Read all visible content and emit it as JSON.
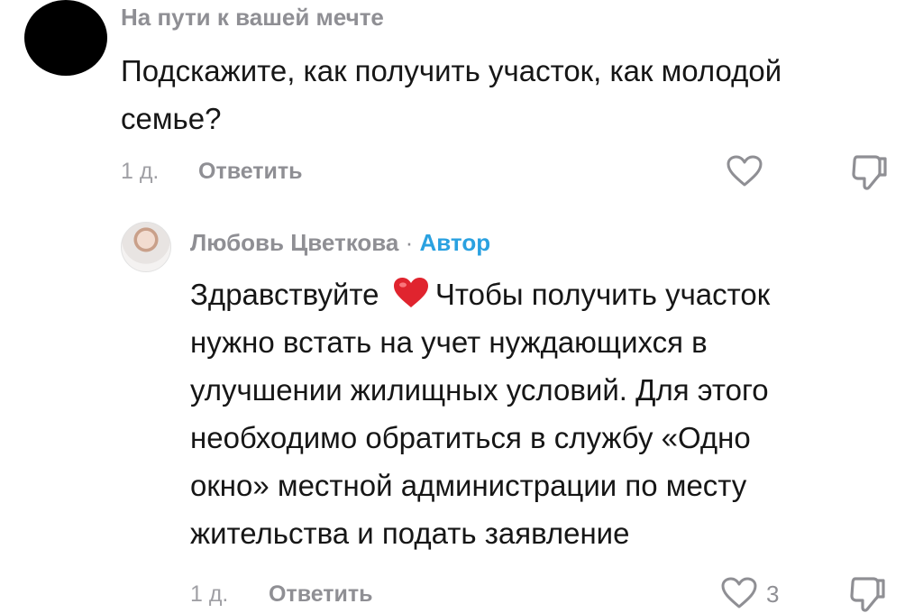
{
  "comment": {
    "username": "На пути к вашей мечте",
    "text_line1": "Подскажите, как получить участок, как молодой",
    "text_line2": "семье?",
    "time": "1 д.",
    "reply_label": "Ответить"
  },
  "reply": {
    "username": "Любовь Цветкова",
    "separator": "·",
    "author_label": "Автор",
    "lines": [
      "Здравствуйте",
      "Чтобы получить участок",
      "нужно встать на учет нуждающихся в",
      "улучшении жилищных условий. Для этого",
      "необходимо обратиться в службу «Одно",
      "окно» местной администрации по месту",
      "жительства и подать заявление"
    ],
    "time": "1 д.",
    "reply_label": "Ответить",
    "like_count": "3"
  },
  "icons": {
    "heart": "heart-outline-icon",
    "dislike": "thumbs-down-icon",
    "emoji": "red-heart-emoji"
  },
  "colors": {
    "author_accent": "#2aa1e0",
    "heart_emoji": "#e0242e"
  }
}
